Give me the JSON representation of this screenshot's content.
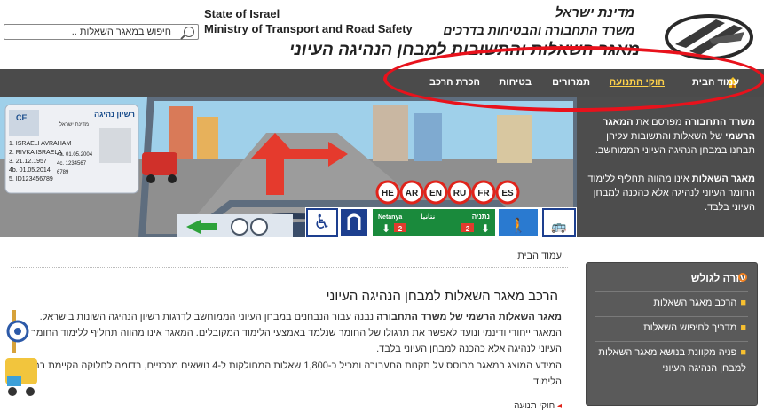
{
  "search": {
    "placeholder": "חיפוש במאגר השאלות .."
  },
  "header": {
    "en_line1": "State of Israel",
    "en_line2": "Ministry of Transport and Road Safety",
    "he_line1": "מדינת ישראל",
    "he_line2": "משרד התחבורה והבטיחות בדרכים",
    "site_title": "מאגר השאלות והתשובות למבחן הנהיגה העיוני"
  },
  "nav": {
    "items": [
      {
        "label": "עמוד הבית"
      },
      {
        "label": "חוקי התנועה"
      },
      {
        "label": "תמרורים"
      },
      {
        "label": "בטיחות"
      },
      {
        "label": "הכרת הרכב"
      }
    ],
    "active_index": 1
  },
  "side_panel": {
    "p1_bold1": "משרד התחבורה",
    "p1_text1": "מפרסם את",
    "p1_bold2": "המאגר הרשמי",
    "p1_text2": "של השאלות והתשובות עליהן תבחנו במבחן הנהיגה העיוני הממוחשב.",
    "p2_bold": "מאגר השאלות",
    "p2_text": "אינו מהווה תחליף ללימוד החומר העיוני לנהיגה אלא כהכנה למבחן העיוני בלבד."
  },
  "banner": {
    "languages": [
      "HE",
      "AR",
      "EN",
      "RU",
      "FR",
      "ES"
    ],
    "sign_city_en": "Netanya",
    "sign_city_he": "נתניה",
    "sign_city_ar": "نتانيا",
    "sign_route": "2",
    "license": {
      "title": "רשיון נהיגה",
      "country": "מדינת ישראל",
      "code": "CE",
      "lines": [
        "1. ISRAELI AVRAHAM",
        "2. RIVKA ISRAELA",
        "3. 21.12.1957",
        "4b. 01.05.2014",
        "5. ID123456789"
      ],
      "right_lines": [
        "4a. 01.05.2004",
        "4c. 1234567",
        "6789"
      ]
    }
  },
  "breadcrumb": "עמוד הבית",
  "main": {
    "title": "הרכב מאגר השאלות למבחן הנהיגה העיוני",
    "p1_bold": "מאגר השאלות הרשמי של משרד התחבורה",
    "p1_text": "נבנה עבור הנבחנים במבחן העיוני הממוחשב לדרגות רשיון הנהיגה השונות בישראל. המאגר ייחודי ודינמי ונועד לאפשר את תרגולו של החומר שנלמד באמצעי הלימוד המקובלים. המאגר אינו מהווה תחליף ללימוד החומר העיוני לנהיגה אלא כהכנה למבחן העיוני בלבד.",
    "p2": "המידע המוצג במאגר מבוסס על תקנות התעבורה ומכיל כ-1,800 שאלות המחולקות ל-4 נושאים מרכזיים, בדומה לחלוקה הקיימת בחומר הלימוד.",
    "bullet_1": "חוקי תנועה"
  },
  "help": {
    "title": "עזרה לגולש",
    "items": [
      "הרכב מאגר השאלות",
      "מדריך לחיפוש השאלות",
      "פניה מקוונת בנושא מאגר השאלות למבחן הנהיגה העיוני"
    ]
  },
  "colors": {
    "nav_bg": "#4b4b4b",
    "annotation_ellipse": "#e8121c",
    "help_bullet": "#f8c030",
    "active_nav": "#ffd24a"
  }
}
